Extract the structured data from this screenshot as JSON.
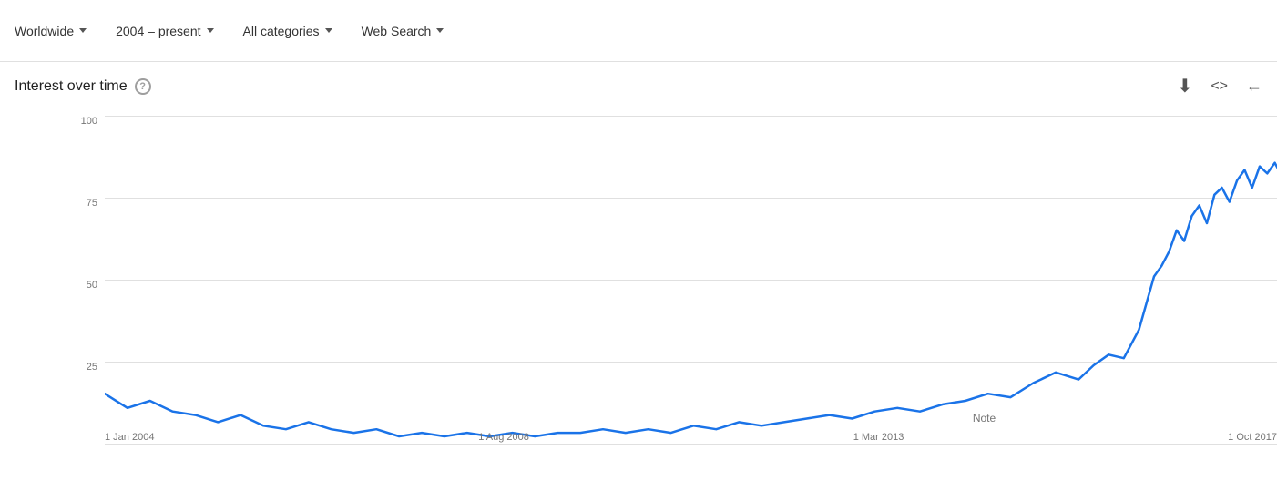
{
  "toolbar": {
    "filters": [
      {
        "label": "Worldwide",
        "id": "region-filter"
      },
      {
        "label": "2004 – present",
        "id": "time-filter"
      },
      {
        "label": "All categories",
        "id": "category-filter"
      },
      {
        "label": "Web Search",
        "id": "search-type-filter"
      }
    ]
  },
  "section": {
    "title": "Interest over time",
    "help_label": "?",
    "actions": {
      "download_label": "⬇",
      "embed_label": "<>",
      "share_label": "⊲"
    }
  },
  "chart": {
    "y_labels": [
      "",
      "25",
      "50",
      "75",
      "100"
    ],
    "x_labels": [
      "1 Jan 2004",
      "1 Aug 2008",
      "1 Mar 2013",
      "1 Oct 2017"
    ],
    "note_label": "Note",
    "accent_color": "#1a73e8"
  }
}
